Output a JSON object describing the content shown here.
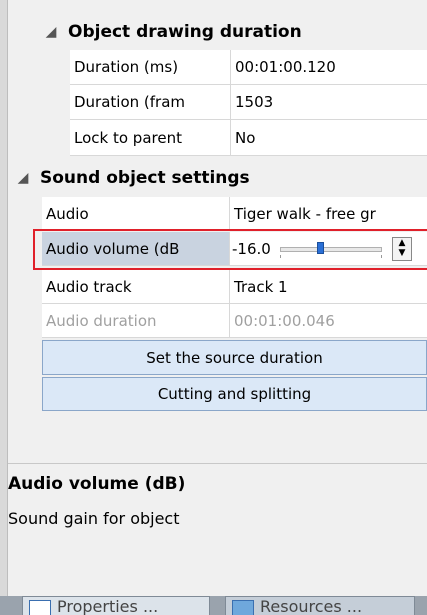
{
  "sections": {
    "drawing": {
      "title": "Object drawing duration",
      "rows": [
        {
          "name": "Duration (ms)",
          "value": "00:01:00.120"
        },
        {
          "name": "Duration (fram",
          "value": "1503"
        },
        {
          "name": "Lock to parent",
          "value": "No"
        }
      ]
    },
    "sound": {
      "title": "Sound object settings",
      "audio": {
        "name": "Audio",
        "value": "Tiger walk -  free gr"
      },
      "volume": {
        "name": "Audio volume (dB",
        "value": "-16.0",
        "slider_level": 0.38
      },
      "track": {
        "name": "Audio track",
        "value": "Track 1"
      },
      "duration": {
        "name": "Audio duration",
        "value": "00:01:00.046"
      }
    }
  },
  "buttons": {
    "set_source": "Set the source duration",
    "cutting": "Cutting and splitting"
  },
  "description": {
    "title": "Audio volume (dB)",
    "text": "Sound gain for object"
  },
  "tabs": {
    "properties": "Properties ...",
    "resources": "Resources ..."
  },
  "colors": {
    "highlight_border": "#e0202a",
    "selected_row": "#c9d3e0",
    "button_fill": "#dbe8f7"
  }
}
